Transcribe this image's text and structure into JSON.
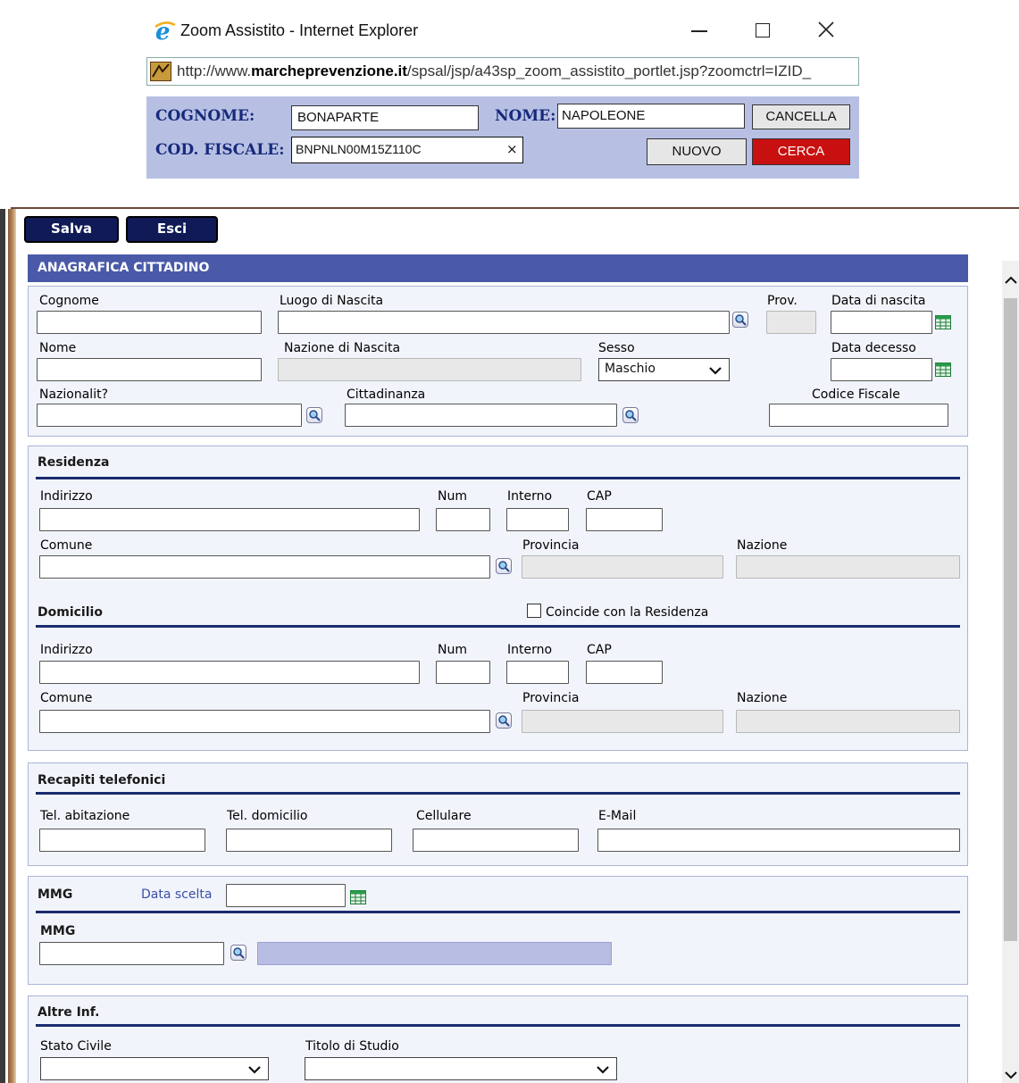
{
  "popup": {
    "title": "Zoom Assistito - Internet Explorer",
    "url_prefix": "http://www.",
    "url_domain": "marcheprevenzione.it",
    "url_path": "/spsal/jsp/a43sp_zoom_assistito_portlet.jsp?zoomctrl=IZID_",
    "cognome_label": "COGNOME:",
    "cognome_value": "BONAPARTE",
    "nome_label": "NOME:",
    "nome_value": "NAPOLEONE",
    "cancella_label": "CANCELLA",
    "codfiscale_label": "COD. FISCALE:",
    "codfiscale_value": "BNPNLN00M15Z110C",
    "clear_glyph": "×",
    "nuovo_label": "NUOVO",
    "cerca_label": "CERCA"
  },
  "toolbar": {
    "salva_label": "Salva",
    "esci_label": "Esci"
  },
  "anagrafica": {
    "header": "ANAGRAFICA CITTADINO",
    "cognome": "Cognome",
    "luogo_nascita": "Luogo di Nascita",
    "prov": "Prov.",
    "data_nascita": "Data di nascita",
    "nome": "Nome",
    "nazione_nascita": "Nazione di Nascita",
    "sesso": "Sesso",
    "sesso_value": "Maschio",
    "data_decesso": "Data decesso",
    "nazionalita": "Nazionalit?",
    "cittadinanza": "Cittadinanza",
    "codice_fiscale": "Codice Fiscale"
  },
  "residenza": {
    "title": "Residenza",
    "indirizzo": "Indirizzo",
    "num": "Num",
    "interno": "Interno",
    "cap": "CAP",
    "comune": "Comune",
    "provincia": "Provincia",
    "nazione": "Nazione"
  },
  "domicilio": {
    "title": "Domicilio",
    "coincide_label": "Coincide con la Residenza",
    "indirizzo": "Indirizzo",
    "num": "Num",
    "interno": "Interno",
    "cap": "CAP",
    "comune": "Comune",
    "provincia": "Provincia",
    "nazione": "Nazione"
  },
  "recapiti": {
    "title": "Recapiti telefonici",
    "tel_abitazione": "Tel. abitazione",
    "tel_domicilio": "Tel. domicilio",
    "cellulare": "Cellulare",
    "email": "E-Mail"
  },
  "mmg": {
    "title": "MMG",
    "data_scelta": "Data scelta",
    "mmg_label": "MMG"
  },
  "altre": {
    "title": "Altre Inf.",
    "stato_civile": "Stato Civile",
    "titolo_studio": "Titolo di Studio"
  },
  "icons": {
    "ie": "ie-logo-icon",
    "minimize": "minimize-icon",
    "maximize": "maximize-icon",
    "close": "close-icon",
    "site": "site-favicon-icon",
    "search": "search-icon",
    "calendar": "calendar-icon",
    "chevron": "chevron-down-icon",
    "scroll_up": "scroll-up-icon",
    "scroll_down": "scroll-down-icon"
  },
  "colors": {
    "accent": "#4a5aa8",
    "dark_button": "#0f1a57",
    "cerca": "#c81010",
    "panel": "#f2f4fb"
  }
}
